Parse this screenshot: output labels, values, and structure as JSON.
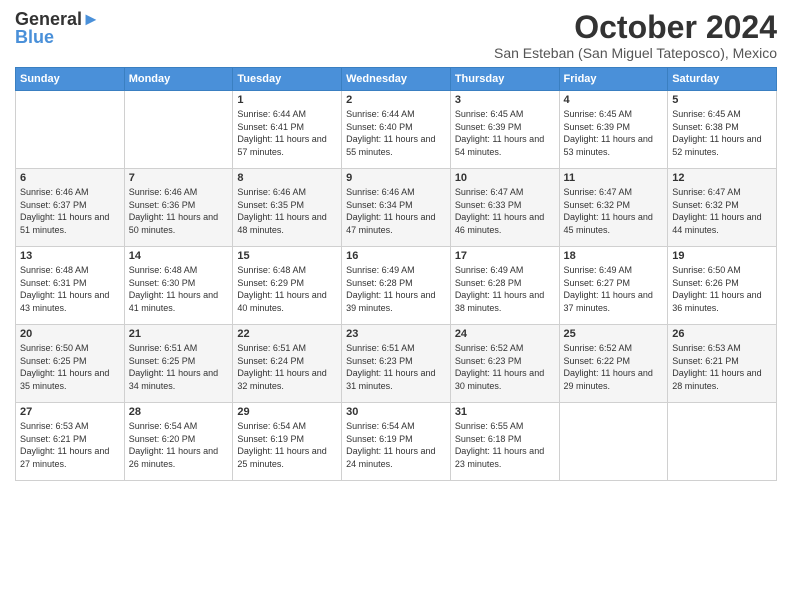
{
  "header": {
    "logo_line1": "General",
    "logo_line2": "Blue",
    "main_title": "October 2024",
    "subtitle": "San Esteban (San Miguel Tateposco), Mexico"
  },
  "days_of_week": [
    "Sunday",
    "Monday",
    "Tuesday",
    "Wednesday",
    "Thursday",
    "Friday",
    "Saturday"
  ],
  "weeks": [
    [
      {
        "day": "",
        "info": ""
      },
      {
        "day": "",
        "info": ""
      },
      {
        "day": "1",
        "info": "Sunrise: 6:44 AM\nSunset: 6:41 PM\nDaylight: 11 hours and 57 minutes."
      },
      {
        "day": "2",
        "info": "Sunrise: 6:44 AM\nSunset: 6:40 PM\nDaylight: 11 hours and 55 minutes."
      },
      {
        "day": "3",
        "info": "Sunrise: 6:45 AM\nSunset: 6:39 PM\nDaylight: 11 hours and 54 minutes."
      },
      {
        "day": "4",
        "info": "Sunrise: 6:45 AM\nSunset: 6:39 PM\nDaylight: 11 hours and 53 minutes."
      },
      {
        "day": "5",
        "info": "Sunrise: 6:45 AM\nSunset: 6:38 PM\nDaylight: 11 hours and 52 minutes."
      }
    ],
    [
      {
        "day": "6",
        "info": "Sunrise: 6:46 AM\nSunset: 6:37 PM\nDaylight: 11 hours and 51 minutes."
      },
      {
        "day": "7",
        "info": "Sunrise: 6:46 AM\nSunset: 6:36 PM\nDaylight: 11 hours and 50 minutes."
      },
      {
        "day": "8",
        "info": "Sunrise: 6:46 AM\nSunset: 6:35 PM\nDaylight: 11 hours and 48 minutes."
      },
      {
        "day": "9",
        "info": "Sunrise: 6:46 AM\nSunset: 6:34 PM\nDaylight: 11 hours and 47 minutes."
      },
      {
        "day": "10",
        "info": "Sunrise: 6:47 AM\nSunset: 6:33 PM\nDaylight: 11 hours and 46 minutes."
      },
      {
        "day": "11",
        "info": "Sunrise: 6:47 AM\nSunset: 6:32 PM\nDaylight: 11 hours and 45 minutes."
      },
      {
        "day": "12",
        "info": "Sunrise: 6:47 AM\nSunset: 6:32 PM\nDaylight: 11 hours and 44 minutes."
      }
    ],
    [
      {
        "day": "13",
        "info": "Sunrise: 6:48 AM\nSunset: 6:31 PM\nDaylight: 11 hours and 43 minutes."
      },
      {
        "day": "14",
        "info": "Sunrise: 6:48 AM\nSunset: 6:30 PM\nDaylight: 11 hours and 41 minutes."
      },
      {
        "day": "15",
        "info": "Sunrise: 6:48 AM\nSunset: 6:29 PM\nDaylight: 11 hours and 40 minutes."
      },
      {
        "day": "16",
        "info": "Sunrise: 6:49 AM\nSunset: 6:28 PM\nDaylight: 11 hours and 39 minutes."
      },
      {
        "day": "17",
        "info": "Sunrise: 6:49 AM\nSunset: 6:28 PM\nDaylight: 11 hours and 38 minutes."
      },
      {
        "day": "18",
        "info": "Sunrise: 6:49 AM\nSunset: 6:27 PM\nDaylight: 11 hours and 37 minutes."
      },
      {
        "day": "19",
        "info": "Sunrise: 6:50 AM\nSunset: 6:26 PM\nDaylight: 11 hours and 36 minutes."
      }
    ],
    [
      {
        "day": "20",
        "info": "Sunrise: 6:50 AM\nSunset: 6:25 PM\nDaylight: 11 hours and 35 minutes."
      },
      {
        "day": "21",
        "info": "Sunrise: 6:51 AM\nSunset: 6:25 PM\nDaylight: 11 hours and 34 minutes."
      },
      {
        "day": "22",
        "info": "Sunrise: 6:51 AM\nSunset: 6:24 PM\nDaylight: 11 hours and 32 minutes."
      },
      {
        "day": "23",
        "info": "Sunrise: 6:51 AM\nSunset: 6:23 PM\nDaylight: 11 hours and 31 minutes."
      },
      {
        "day": "24",
        "info": "Sunrise: 6:52 AM\nSunset: 6:23 PM\nDaylight: 11 hours and 30 minutes."
      },
      {
        "day": "25",
        "info": "Sunrise: 6:52 AM\nSunset: 6:22 PM\nDaylight: 11 hours and 29 minutes."
      },
      {
        "day": "26",
        "info": "Sunrise: 6:53 AM\nSunset: 6:21 PM\nDaylight: 11 hours and 28 minutes."
      }
    ],
    [
      {
        "day": "27",
        "info": "Sunrise: 6:53 AM\nSunset: 6:21 PM\nDaylight: 11 hours and 27 minutes."
      },
      {
        "day": "28",
        "info": "Sunrise: 6:54 AM\nSunset: 6:20 PM\nDaylight: 11 hours and 26 minutes."
      },
      {
        "day": "29",
        "info": "Sunrise: 6:54 AM\nSunset: 6:19 PM\nDaylight: 11 hours and 25 minutes."
      },
      {
        "day": "30",
        "info": "Sunrise: 6:54 AM\nSunset: 6:19 PM\nDaylight: 11 hours and 24 minutes."
      },
      {
        "day": "31",
        "info": "Sunrise: 6:55 AM\nSunset: 6:18 PM\nDaylight: 11 hours and 23 minutes."
      },
      {
        "day": "",
        "info": ""
      },
      {
        "day": "",
        "info": ""
      }
    ]
  ]
}
